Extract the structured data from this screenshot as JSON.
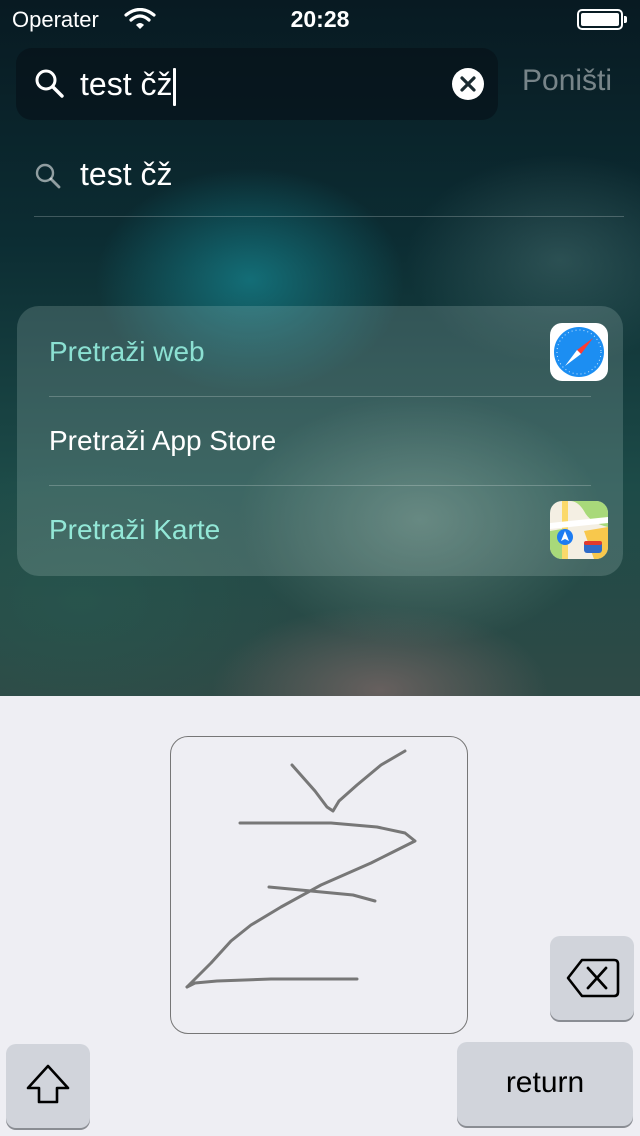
{
  "status_bar": {
    "carrier": "Operater",
    "time": "20:28"
  },
  "search": {
    "query": "test čž",
    "cancel_label": "Poništi"
  },
  "suggestion": {
    "text": "test čž"
  },
  "results": {
    "items": [
      {
        "label": "Pretraži web",
        "icon": "safari-icon"
      },
      {
        "label": "Pretraži App Store",
        "icon": ""
      },
      {
        "label": "Pretraži Karte",
        "icon": "maps-icon"
      }
    ]
  },
  "keyboard": {
    "mode": "handwriting",
    "return_label": "return"
  },
  "colors": {
    "result_teal": "#8be0d2",
    "keyboard_bg": "#eeeef3",
    "key_bg": "#d1d4db",
    "stroke": "#777777"
  }
}
